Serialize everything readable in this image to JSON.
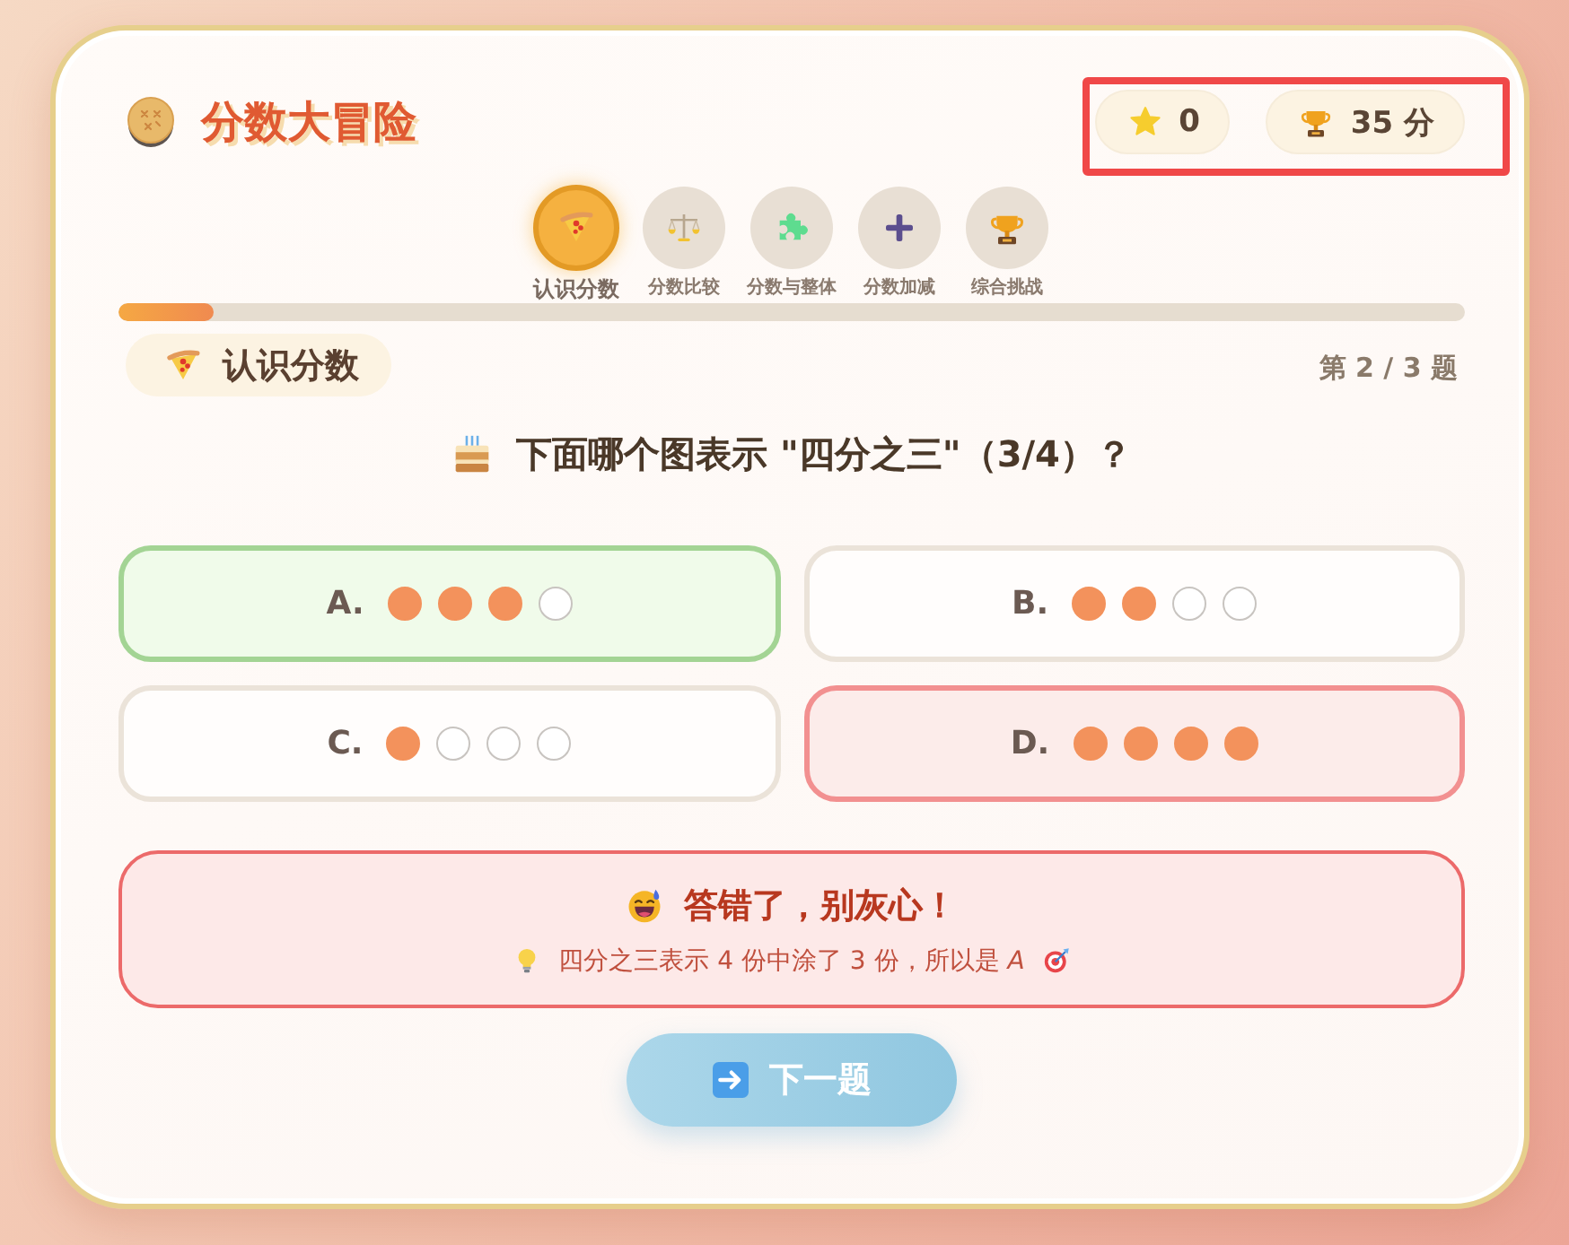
{
  "header": {
    "title": "分数大冒险",
    "star_count": "0",
    "points": "35 分",
    "highlight": true
  },
  "levels": [
    {
      "label": "认识分数",
      "selected": true
    },
    {
      "label": "分数比较",
      "selected": false
    },
    {
      "label": "分数与整体",
      "selected": false
    },
    {
      "label": "分数加减",
      "selected": false
    },
    {
      "label": "综合挑战",
      "selected": false
    }
  ],
  "progress": {
    "level": 0.07
  },
  "topic": {
    "label": "认识分数"
  },
  "counter": "第 2 / 3 题",
  "question": "下面哪个图表示 \"四分之三\"（3/4）？",
  "options": [
    {
      "letter": "A.",
      "selected": false,
      "correct": true,
      "parts": [
        {
          "shaded": true
        },
        {
          "shaded": true
        },
        {
          "shaded": true
        },
        {
          "shaded": false
        }
      ]
    },
    {
      "letter": "B.",
      "selected": false,
      "correct": false,
      "parts": [
        {
          "shaded": true
        },
        {
          "shaded": true
        },
        {
          "shaded": false
        },
        {
          "shaded": false
        }
      ]
    },
    {
      "letter": "C.",
      "selected": false,
      "correct": false,
      "parts": [
        {
          "shaded": true
        },
        {
          "shaded": false
        },
        {
          "shaded": false
        },
        {
          "shaded": false
        }
      ]
    },
    {
      "letter": "D.",
      "selected": true,
      "correct": false,
      "parts": [
        {
          "shaded": true
        },
        {
          "shaded": true
        },
        {
          "shaded": true
        },
        {
          "shaded": true
        }
      ]
    }
  ],
  "feedback": {
    "correct": false,
    "title": "答错了，别灰心！",
    "explanation": "四分之三表示 4 份中涂了 3 份，所以是 *A*"
  },
  "next_button": "下一题"
}
